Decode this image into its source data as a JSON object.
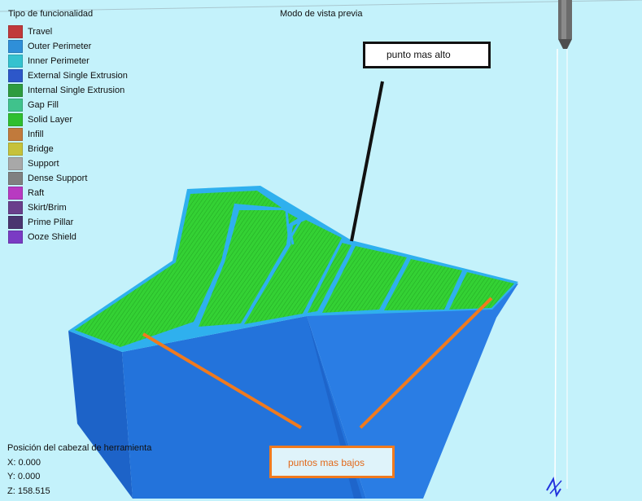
{
  "header": {
    "legend_title": "Tipo de funcionalidad",
    "view_mode": "Modo de vista previa"
  },
  "legend": [
    {
      "label": "Travel",
      "color": "#c0393b"
    },
    {
      "label": "Outer Perimeter",
      "color": "#2f8fd8"
    },
    {
      "label": "Inner Perimeter",
      "color": "#34c2cf"
    },
    {
      "label": "External Single Extrusion",
      "color": "#2d57c9"
    },
    {
      "label": "Internal Single Extrusion",
      "color": "#2e9c3f"
    },
    {
      "label": "Gap Fill",
      "color": "#40c28c"
    },
    {
      "label": "Solid Layer",
      "color": "#2fbf2f"
    },
    {
      "label": "Infill",
      "color": "#c17a3c"
    },
    {
      "label": "Bridge",
      "color": "#c6c23a"
    },
    {
      "label": "Support",
      "color": "#a8a8a8"
    },
    {
      "label": "Dense Support",
      "color": "#808080"
    },
    {
      "label": "Raft",
      "color": "#b83ac1"
    },
    {
      "label": "Skirt/Brim",
      "color": "#6a3f8c"
    },
    {
      "label": "Prime Pillar",
      "color": "#4a3570"
    },
    {
      "label": "Ooze Shield",
      "color": "#7a3bc4"
    }
  ],
  "tool_position": {
    "title": "Posición del cabezal de herramienta",
    "x": "X: 0.000",
    "y": "Y: 0.000",
    "z": "Z: 158.515"
  },
  "annotations": {
    "highest": "punto mas alto",
    "lowest": "puntos mas bajos"
  },
  "colors": {
    "background": "#c4f2fb",
    "model_body": "#1f6fd6",
    "top_surface": "#2ecc2e",
    "perimeter": "#2fa8e8",
    "annotation_orange": "#f07a1e"
  }
}
